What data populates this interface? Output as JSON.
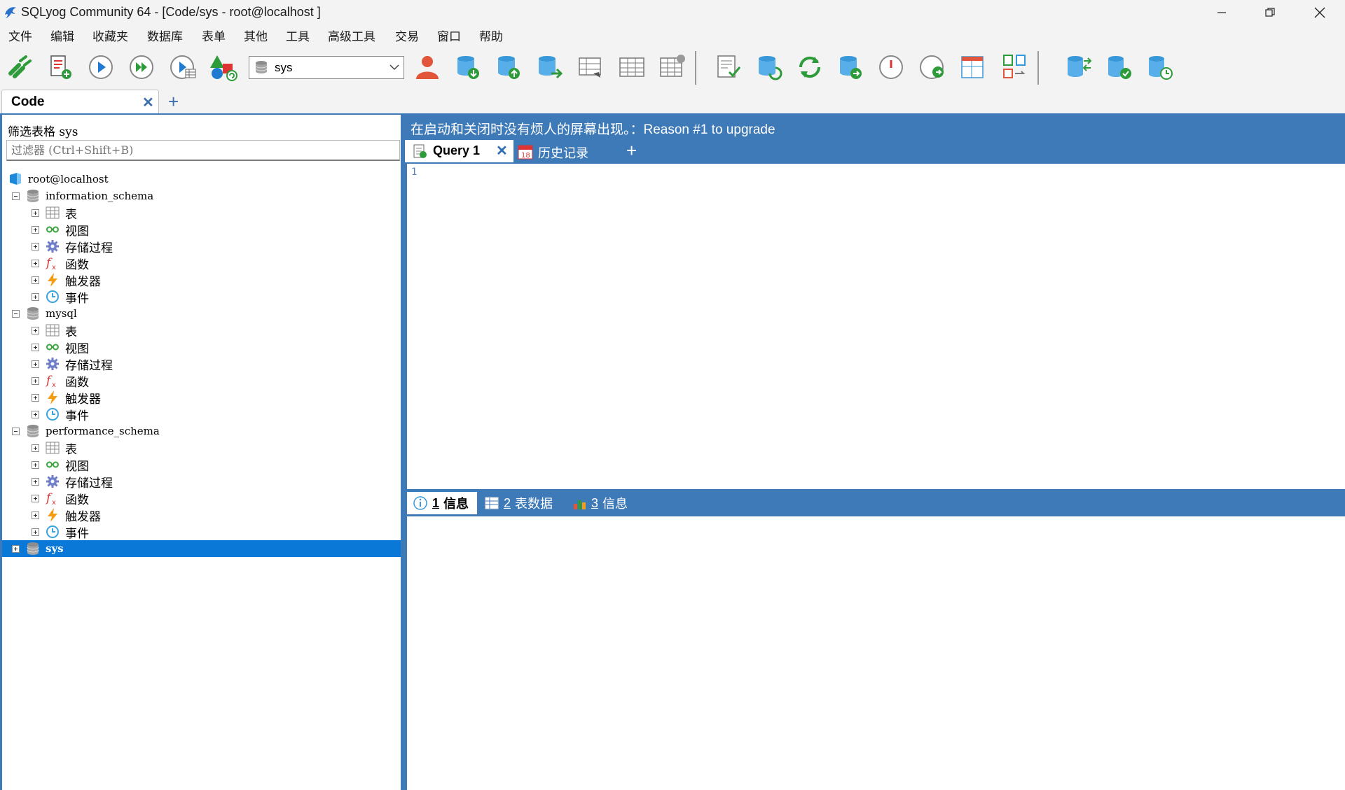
{
  "window": {
    "title": "SQLyog Community 64 - [Code/sys - root@localhost ]"
  },
  "menu": [
    "文件",
    "编辑",
    "收藏夹",
    "数据库",
    "表单",
    "其他",
    "工具",
    "高级工具",
    "交易",
    "窗口",
    "帮助"
  ],
  "toolbar": {
    "database_selected": "sys",
    "buttons": [
      "new-connection-icon",
      "new-query-icon",
      "execute-query-icon",
      "execute-all-icon",
      "execute-with-grid-icon",
      "create-object-icon",
      "user-manager-icon",
      "backup-icon",
      "restore-icon",
      "copy-database-icon",
      "schema-designer-icon",
      "query-builder-icon",
      "table-diagnostics-icon",
      "check-query-icon",
      "sync-schema-icon",
      "refresh-icon",
      "import-external-icon",
      "scheduler-icon",
      "notification-icon",
      "visual-data-compare-icon",
      "migration-icon",
      "database-sync-icon",
      "schema-sync-icon",
      "backup-schedule-icon"
    ]
  },
  "connection_tab": {
    "label": "Code",
    "add": "+"
  },
  "object_browser": {
    "filter_caption": "筛选表格 sys",
    "filter_placeholder": "过滤器 (Ctrl+Shift+B)",
    "connection": "root@localhost",
    "databases": [
      {
        "name": "information_schema",
        "expanded": true
      },
      {
        "name": "mysql",
        "expanded": true
      },
      {
        "name": "performance_schema",
        "expanded": true
      },
      {
        "name": "sys",
        "expanded": false,
        "selected": true
      }
    ],
    "folder_labels": [
      "表",
      "视图",
      "存储过程",
      "函数",
      "触发器",
      "事件"
    ]
  },
  "upgrade_notice": "在启动和关闭时没有烦人的屏幕出现。：Reason #1 to upgrade",
  "query_tabs": {
    "query": "Query 1",
    "history": "历史记录",
    "add": "+"
  },
  "editor": {
    "line_number": "1"
  },
  "result_tabs": [
    {
      "num": "1",
      "label": "信息"
    },
    {
      "num": "2",
      "label": "表数据"
    },
    {
      "num": "3",
      "label": "信息"
    }
  ],
  "colors": {
    "accent_blue": "#3f7ab8",
    "selection": "#0a78d7",
    "chrome": "#f3f3f3"
  }
}
